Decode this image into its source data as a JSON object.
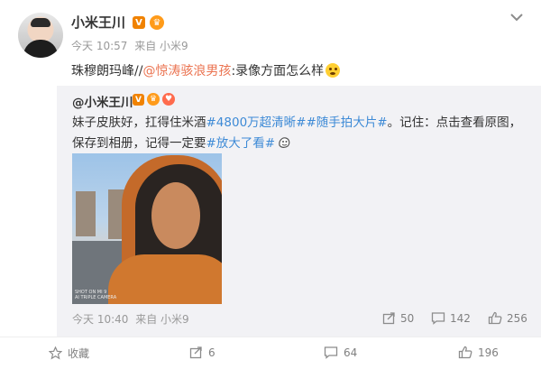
{
  "post": {
    "author": "小米王川",
    "verified_badge": "V",
    "timestamp": "今天 10:57",
    "source": "来自 小米9",
    "text_prefix": "珠穆朗玛峰//",
    "mention": "@惊涛骇浪男孩",
    "text_suffix": ":录像方面怎么样"
  },
  "repost": {
    "author": "@小米王川",
    "verified_badge": "V",
    "text_part1": "妹子皮肤好，扛得住米酒",
    "topic1": "#4800万超清晰#",
    "topic2": "#随手拍大片#",
    "text_part2": "。记住：点击查看原图，保存到相册，记得一定要",
    "topic3": "#放大了看#",
    "photo_watermark_line1": "SHOT ON MI 9",
    "photo_watermark_line2": "AI TRIPLE CAMERA",
    "timestamp": "今天 10:40",
    "source": "来自 小米9",
    "repost_count": "50",
    "comment_count": "142",
    "like_count": "256"
  },
  "bottom_bar": {
    "favorite_label": "收藏",
    "repost_count": "6",
    "comment_count": "64",
    "like_count": "196"
  },
  "colors": {
    "accent_orange": "#eb7350",
    "topic_blue": "#3d8ad6",
    "repost_bg": "#f2f2f5"
  },
  "icons": [
    "avatar",
    "verified-v-icon",
    "crown-icon",
    "heart-badge-icon",
    "chevron-down-icon",
    "shocked-emoji-icon",
    "cheeky-emoji-icon",
    "star-icon",
    "share-icon",
    "comment-icon",
    "thumbs-up-icon"
  ]
}
